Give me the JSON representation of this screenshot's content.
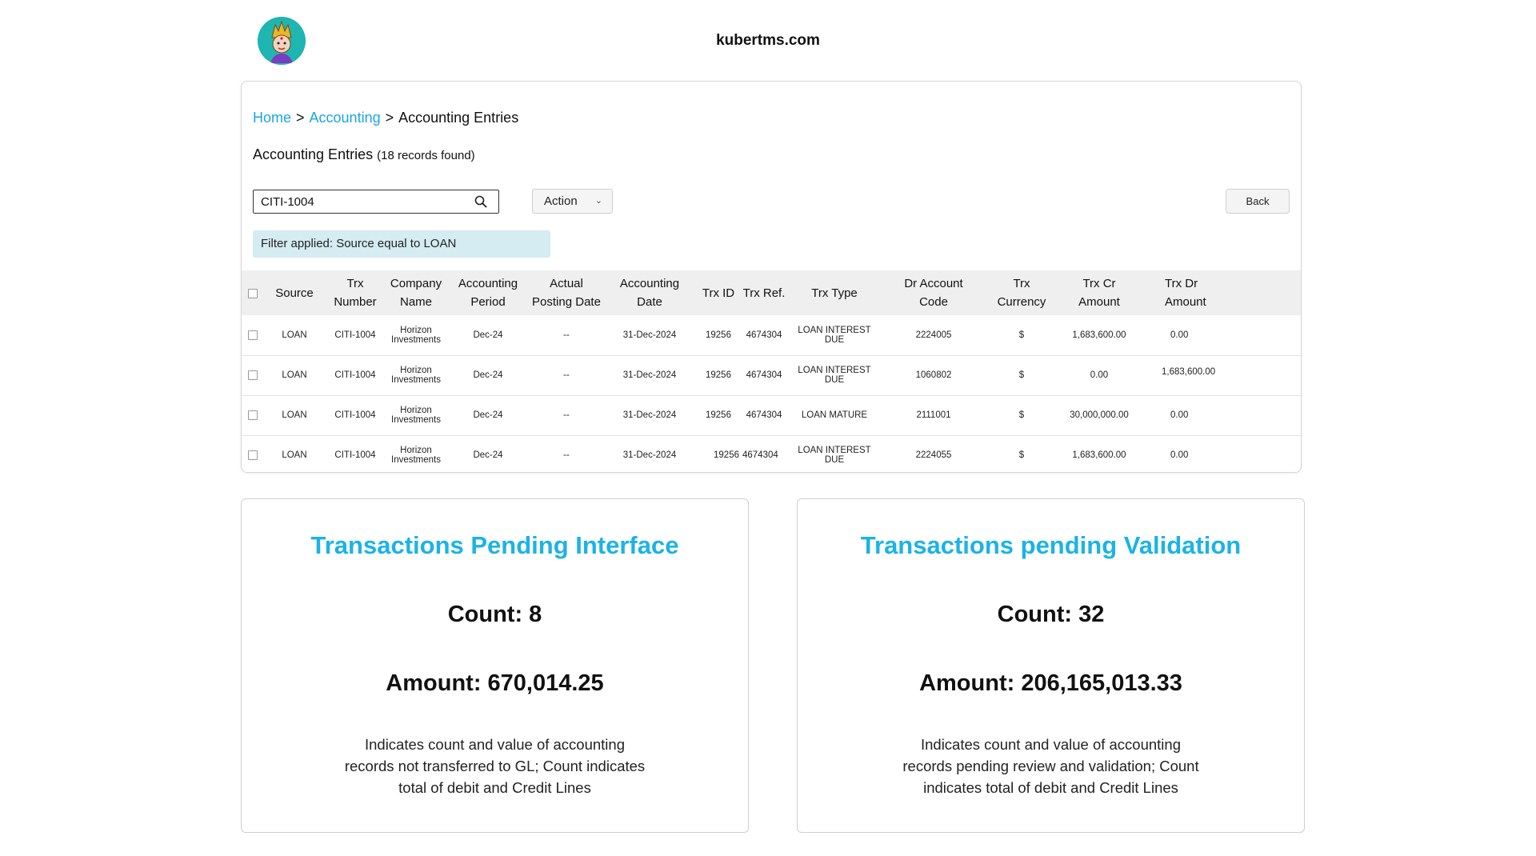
{
  "header": {
    "site": "kubertms.com"
  },
  "breadcrumb": {
    "home": "Home",
    "sep": ">",
    "accounting": "Accounting",
    "current": "Accounting Entries"
  },
  "page": {
    "title": "Accounting Entries",
    "records": "(18 records found)"
  },
  "toolbar": {
    "search_value": "CITI-1004",
    "action_label": "Action",
    "back_label": "Back"
  },
  "filter": {
    "text": "Filter applied: Source equal to LOAN"
  },
  "table": {
    "columns": [
      [
        "Source"
      ],
      [
        "Trx",
        "Number"
      ],
      [
        "Company",
        "Name"
      ],
      [
        "Accounting",
        "Period"
      ],
      [
        "Actual",
        "Posting Date"
      ],
      [
        "Accounting",
        "Date"
      ],
      [
        "Trx ID"
      ],
      [
        "Trx Ref."
      ],
      [
        "Trx Type"
      ],
      [
        "Dr Account",
        "Code"
      ],
      [
        "Trx",
        "Currency"
      ],
      [
        "Trx Cr",
        "Amount"
      ],
      [
        "Trx Dr",
        "Amount"
      ]
    ],
    "rows": [
      {
        "source": "LOAN",
        "trx_number": "CITI-1004",
        "company_1": "Horizon",
        "company_2": "Investments",
        "period": "Dec-24",
        "posting_date": "--",
        "acc_date": "31-Dec-2024",
        "trx_id": "19256",
        "trx_ref": "4674304",
        "trx_type": "LOAN INTEREST DUE",
        "dr_account": "2224005",
        "currency": "$",
        "cr_amount": "1,683,600.00",
        "dr_amount": "0.00"
      },
      {
        "source": "LOAN",
        "trx_number": "CITI-1004",
        "company_1": "Horizon",
        "company_2": "Investments",
        "period": "Dec-24",
        "posting_date": "--",
        "acc_date": "31-Dec-2024",
        "trx_id": "19256",
        "trx_ref": "4674304",
        "trx_type": "LOAN INTEREST DUE",
        "dr_account": "1060802",
        "currency": "$",
        "cr_amount": "0.00",
        "dr_amount": "1,683,600.00"
      },
      {
        "source": "LOAN",
        "trx_number": "CITI-1004",
        "company_1": "Horizon",
        "company_2": "Investments",
        "period": "Dec-24",
        "posting_date": "--",
        "acc_date": "31-Dec-2024",
        "trx_id": "19256",
        "trx_ref": "4674304",
        "trx_type": "LOAN MATURE",
        "dr_account": "2111001",
        "currency": "$",
        "cr_amount": "30,000,000.00",
        "dr_amount": "0.00"
      },
      {
        "source": "LOAN",
        "trx_number": "CITI-1004",
        "company_1": "Horizon",
        "company_2": "Investments",
        "period": "Dec-24",
        "posting_date": "--",
        "acc_date": "31-Dec-2024",
        "trx_id": "19256",
        "trx_ref": "4674304",
        "trx_type": "LOAN INTEREST DUE",
        "dr_account": "2224055",
        "currency": "$",
        "cr_amount": "1,683,600.00",
        "dr_amount": "0.00"
      }
    ]
  },
  "cards": {
    "interface": {
      "title": "Transactions Pending Interface",
      "count": "Count: 8",
      "amount": "Amount: 670,014.25",
      "desc": [
        "Indicates count and value of accounting",
        "records not transferred to GL; Count indicates",
        "total of debit and Credit Lines"
      ]
    },
    "validation": {
      "title": "Transactions pending Validation",
      "count": "Count: 32",
      "amount": "Amount: 206,165,013.33",
      "desc": [
        "Indicates count and value of accounting",
        "records pending review and validation; Count",
        "indicates total of debit and Credit Lines"
      ]
    }
  },
  "colors": {
    "accent": "#1bb3e6",
    "link": "#1aa7e0",
    "filter_bg": "#d4ecf2",
    "logo_bg": "#1fb5b0"
  }
}
